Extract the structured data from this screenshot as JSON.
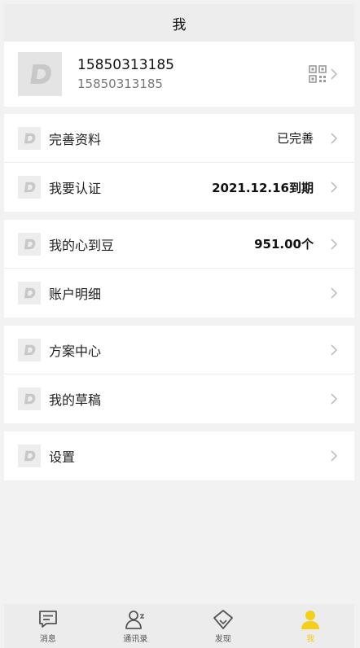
{
  "header": {
    "title": "我"
  },
  "profile": {
    "name": "15850313185",
    "phone": "15850313185",
    "avatar_icon": "app-logo-d-icon",
    "qr_icon": "qrcode-icon"
  },
  "groups": [
    {
      "items": [
        {
          "label": "完善资料",
          "value": "已完善",
          "bold": false
        },
        {
          "label": "我要认证",
          "value": "2021.12.16到期",
          "bold": true
        }
      ]
    },
    {
      "items": [
        {
          "label": "我的心到豆",
          "value": "951.00个",
          "bold": true
        },
        {
          "label": "账户明细",
          "value": "",
          "bold": false
        }
      ]
    },
    {
      "items": [
        {
          "label": "方案中心",
          "value": "",
          "bold": false
        },
        {
          "label": "我的草稿",
          "value": "",
          "bold": false
        }
      ]
    },
    {
      "items": [
        {
          "label": "设置",
          "value": "",
          "bold": false
        }
      ]
    }
  ],
  "tabs": [
    {
      "label": "消息",
      "icon": "message-icon",
      "active": false
    },
    {
      "label": "通讯录",
      "icon": "contacts-icon",
      "active": false
    },
    {
      "label": "发现",
      "icon": "discover-icon",
      "active": false
    },
    {
      "label": "我",
      "icon": "me-icon",
      "active": true
    }
  ],
  "colors": {
    "accent": "#f4cf1b",
    "icon_gray": "#c8c8c8",
    "background": "#f2f2f2"
  }
}
